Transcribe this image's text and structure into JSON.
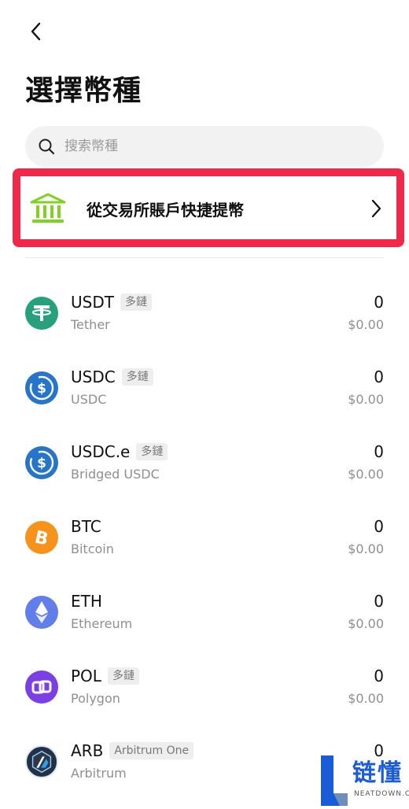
{
  "header": {
    "back_icon": "chevron-left-icon",
    "title": "選擇幣種"
  },
  "search": {
    "placeholder": "搜索幣種",
    "value": "",
    "icon": "search-icon"
  },
  "quick_withdraw": {
    "label": "從交易所賬戶快捷提幣",
    "icon": "bank-icon",
    "highlight_color": "#f0294a",
    "icon_color": "#7ed321"
  },
  "coins": [
    {
      "ticker": "USDT",
      "tag": "多鏈",
      "name": "Tether",
      "amount": "0",
      "fiat": "$0.00",
      "icon": "tether-icon",
      "color": "#26a17b"
    },
    {
      "ticker": "USDC",
      "tag": "多鏈",
      "name": "USDC",
      "amount": "0",
      "fiat": "$0.00",
      "icon": "usdc-icon",
      "color": "#2775ca"
    },
    {
      "ticker": "USDC.e",
      "tag": "多鏈",
      "name": "Bridged USDC",
      "amount": "0",
      "fiat": "$0.00",
      "icon": "usdc-icon",
      "color": "#2775ca"
    },
    {
      "ticker": "BTC",
      "tag": "",
      "name": "Bitcoin",
      "amount": "0",
      "fiat": "$0.00",
      "icon": "bitcoin-icon",
      "color": "#f7931a"
    },
    {
      "ticker": "ETH",
      "tag": "",
      "name": "Ethereum",
      "amount": "0",
      "fiat": "$0.00",
      "icon": "ethereum-icon",
      "color": "#627eea"
    },
    {
      "ticker": "POL",
      "tag": "多鏈",
      "name": "Polygon",
      "amount": "0",
      "fiat": "$0.00",
      "icon": "polygon-icon",
      "color": "#7b3fe4"
    },
    {
      "ticker": "ARB",
      "tag": "Arbitrum One",
      "name": "Arbitrum",
      "amount": "0",
      "fiat": "$0.00",
      "icon": "arbitrum-icon",
      "color": "#213147"
    }
  ],
  "watermark": {
    "text": "链懂",
    "subtext": "NEATDOWN.COM"
  }
}
